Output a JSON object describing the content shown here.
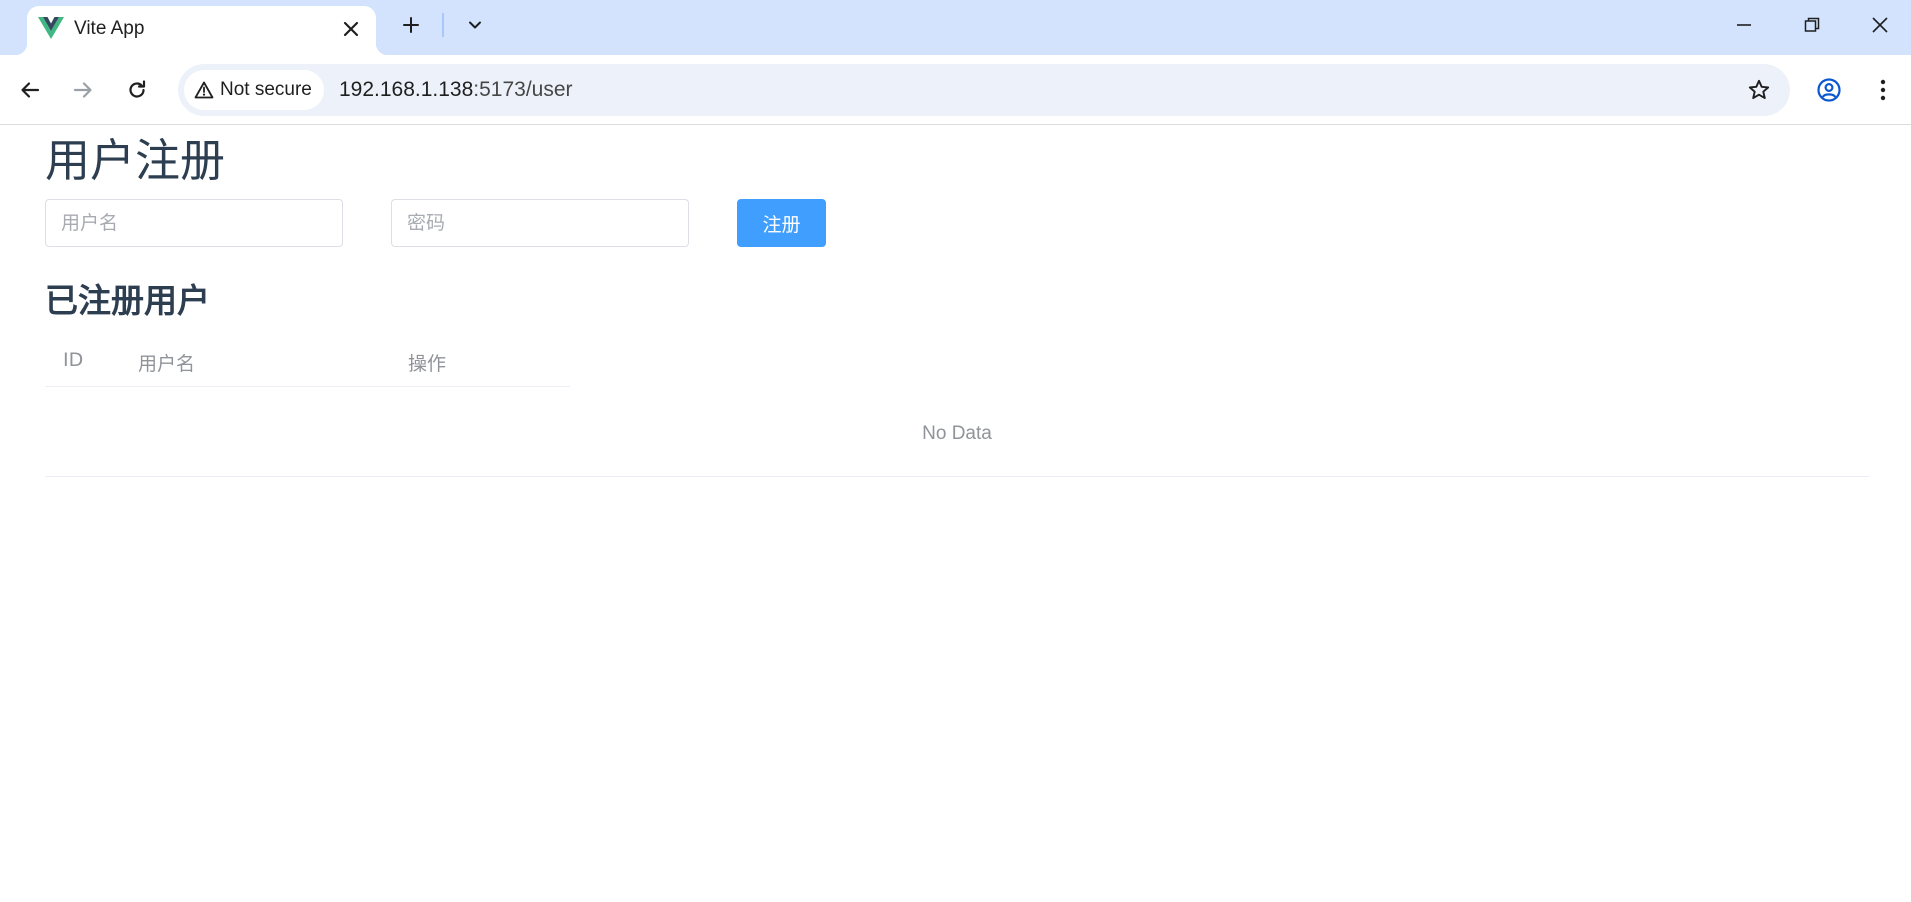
{
  "browser": {
    "tab": {
      "title": "Vite App",
      "favicon": "vue-logo-icon"
    },
    "omnibox": {
      "security_label": "Not secure",
      "url_host": "192.168.1.138",
      "url_rest": ":5173/user"
    }
  },
  "page": {
    "title": "用户注册",
    "form": {
      "username_placeholder": "用户名",
      "username_value": "",
      "password_placeholder": "密码",
      "password_value": "",
      "submit_label": "注册"
    },
    "users_section": {
      "title": "已注册用户",
      "columns": [
        "ID",
        "用户名",
        "操作"
      ],
      "rows": [],
      "empty_text": "No Data"
    }
  },
  "colors": {
    "primary": "#409eff",
    "heading": "#2c3e50",
    "muted": "#909399",
    "tabstrip": "#d3e3fd"
  }
}
